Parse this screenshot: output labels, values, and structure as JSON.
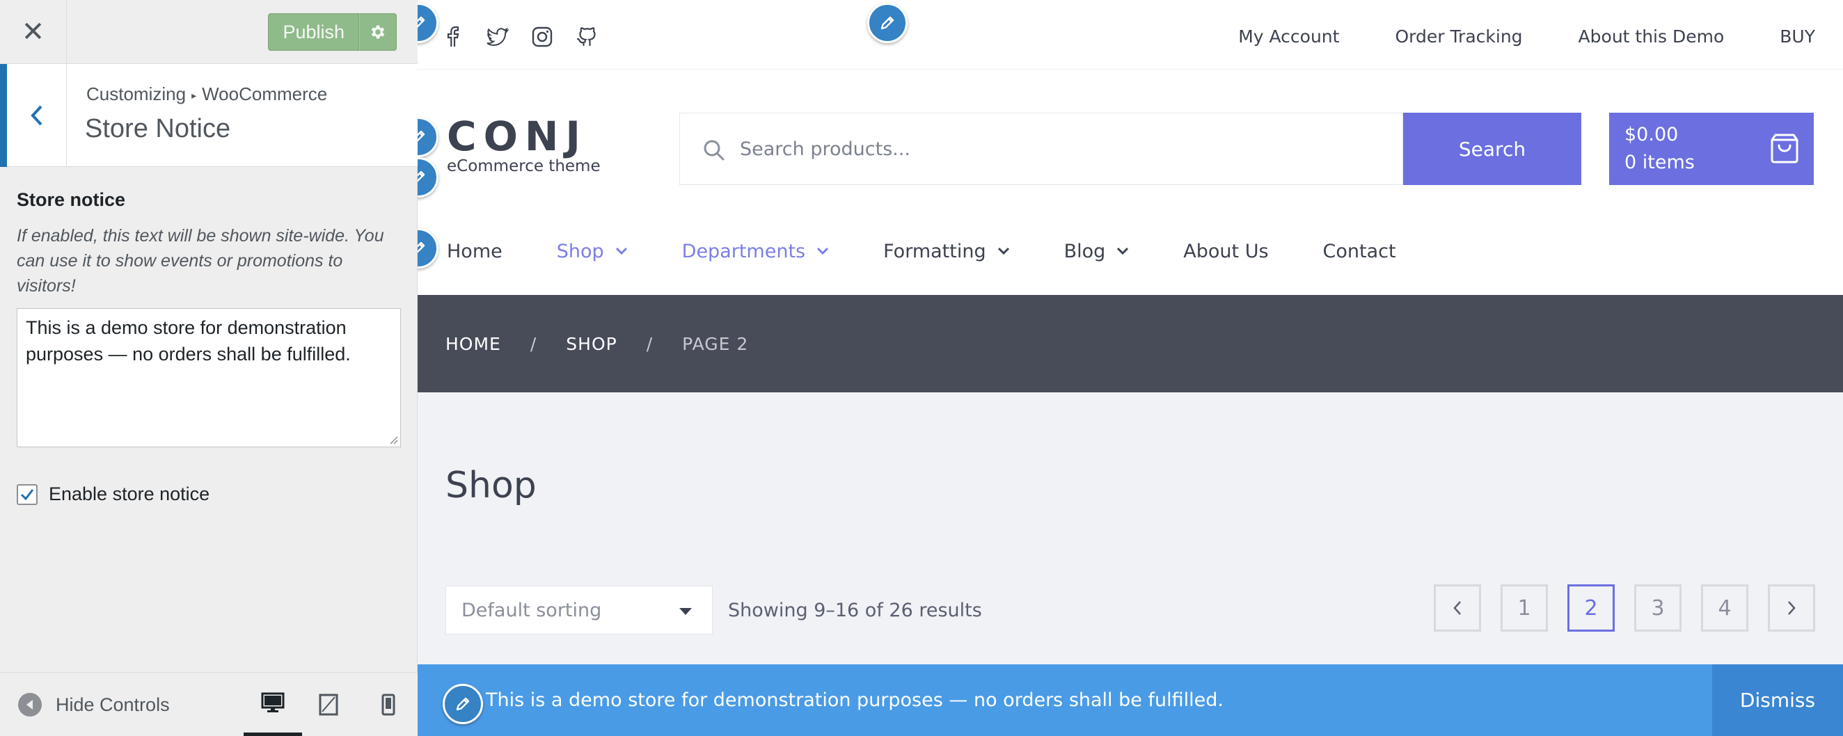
{
  "customizer": {
    "publish_label": "Publish",
    "breadcrumb_root": "Customizing",
    "breadcrumb_section": "WooCommerce",
    "section_title": "Store Notice",
    "control_label": "Store notice",
    "control_description": "If enabled, this text will be shown site-wide. You can use it to show events or promotions to visitors!",
    "notice_text": "This is a demo store for demonstration purposes — no orders shall be fulfilled.",
    "enable_checkbox_label": "Enable store notice",
    "enable_checked": true,
    "hide_controls_label": "Hide Controls",
    "active_device": "desktop"
  },
  "site": {
    "social_icons": [
      "facebook-icon",
      "twitter-icon",
      "instagram-icon",
      "github-icon"
    ],
    "top_nav": [
      "My Account",
      "Order Tracking",
      "About this Demo",
      "BUY"
    ],
    "logo": "CONJ",
    "tagline": "eCommerce theme",
    "search_placeholder": "Search products...",
    "search_button": "Search",
    "cart_amount": "$0.00",
    "cart_items": "0 items",
    "main_nav": [
      {
        "label": "Home",
        "dropdown": false,
        "accent": false
      },
      {
        "label": "Shop",
        "dropdown": true,
        "accent": true
      },
      {
        "label": "Departments",
        "dropdown": true,
        "accent": true
      },
      {
        "label": "Formatting",
        "dropdown": true,
        "accent": false
      },
      {
        "label": "Blog",
        "dropdown": true,
        "accent": false
      },
      {
        "label": "About Us",
        "dropdown": false,
        "accent": false
      },
      {
        "label": "Contact",
        "dropdown": false,
        "accent": false
      }
    ],
    "breadcrumb": [
      "HOME",
      "SHOP",
      "PAGE 2"
    ],
    "page_title": "Shop",
    "sorting_selected": "Default sorting",
    "result_count": "Showing 9–16 of 26 results",
    "pagination": {
      "pages": [
        "1",
        "2",
        "3",
        "4"
      ],
      "current": "2"
    },
    "store_notice": "This is a demo store for demonstration purposes — no orders shall be fulfilled.",
    "dismiss_label": "Dismiss"
  },
  "colors": {
    "accent": "#6b6fe0",
    "notice_bar": "#4a9be6",
    "breadcrumb_bar": "#484b58",
    "publish_button": "#8fba8a",
    "customizer_accent": "#2271b1"
  }
}
